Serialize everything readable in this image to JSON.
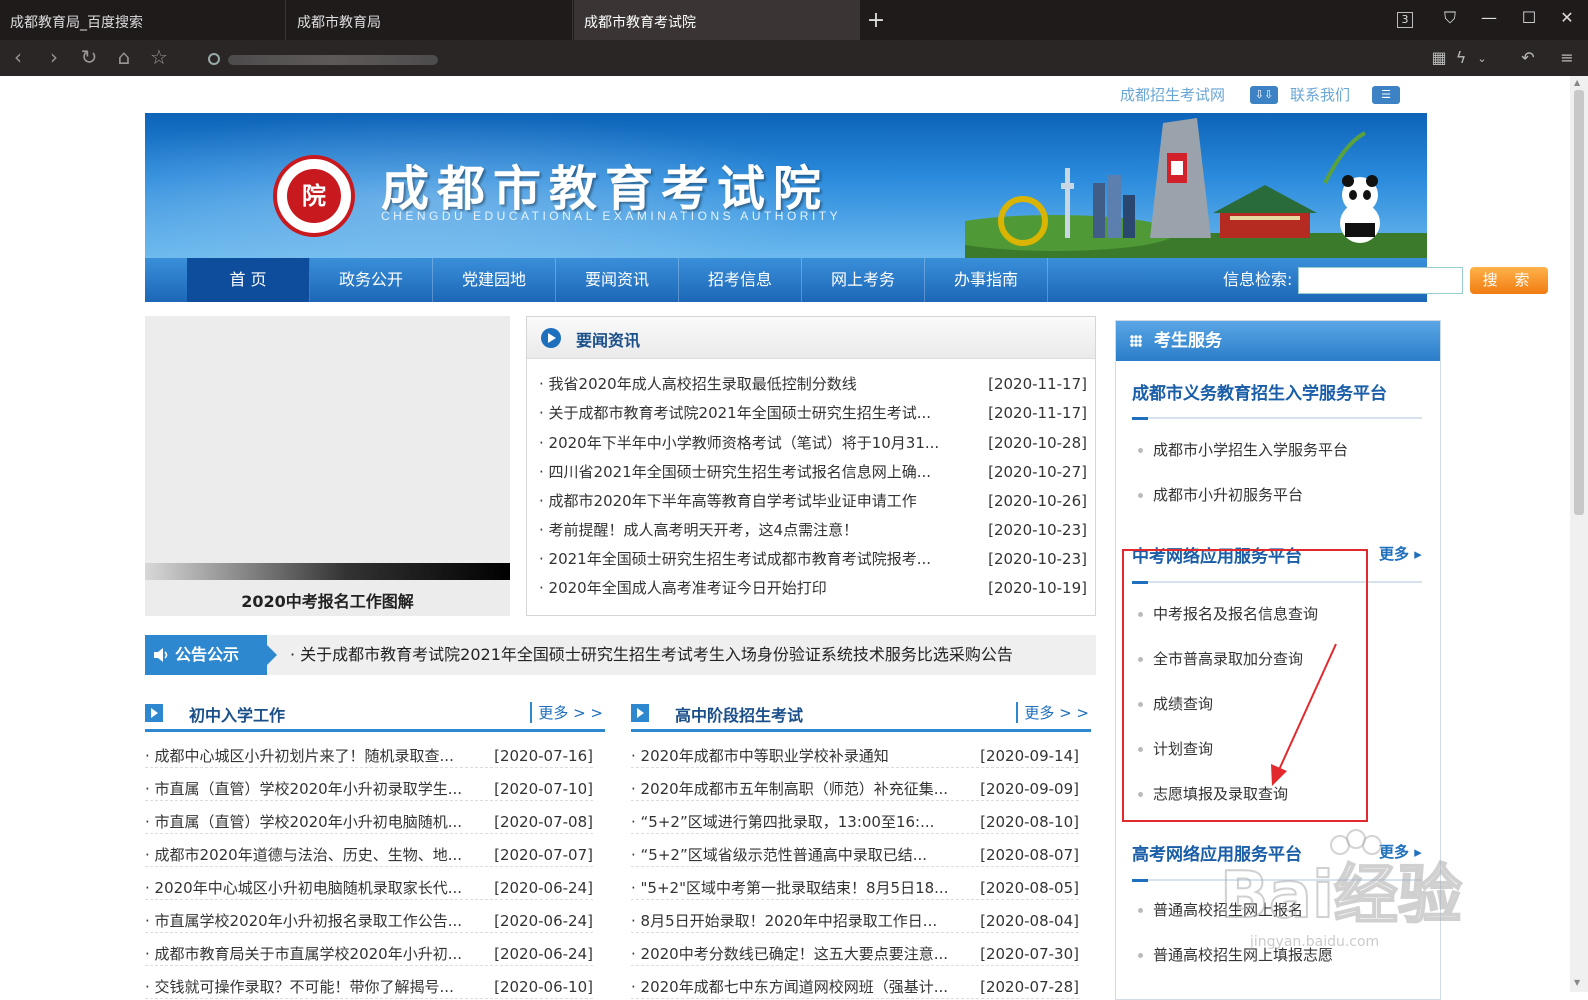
{
  "browser": {
    "tabs": [
      {
        "label": "成都教育局_百度搜索",
        "active": false
      },
      {
        "label": "成都市教育局",
        "active": false
      },
      {
        "label": "成都市教育考试院",
        "active": true
      }
    ],
    "new_tab": "+",
    "tab_count": "3",
    "icons": [
      "back-icon",
      "forward-icon",
      "reload-icon",
      "home-icon",
      "star-icon",
      "qr-icon",
      "lightning-icon",
      "undo-icon",
      "menu-icon"
    ]
  },
  "toplinks": {
    "link1": "成都招生考试网",
    "link2": "联系我们"
  },
  "banner": {
    "title": "成都市教育考试院",
    "subtitle": "CHENGDU EDUCATIONAL EXAMINATIONS AUTHORITY",
    "seal_char": "院"
  },
  "nav": {
    "items": [
      "首 页",
      "政务公开",
      "党建园地",
      "要闻资讯",
      "招考信息",
      "网上考务",
      "办事指南"
    ],
    "search_label": "信息检索:",
    "search_button": "搜 索"
  },
  "slide": {
    "caption": "2020中考报名工作图解"
  },
  "news": {
    "title": "要闻资讯",
    "items": [
      {
        "title": "· 我省2020年成人高校招生录取最低控制分数线",
        "date": "[2020-11-17]"
      },
      {
        "title": "· 关于成都市教育考试院2021年全国硕士研究生招生考试...",
        "date": "[2020-11-17]"
      },
      {
        "title": "· 2020年下半年中小学教师资格考试（笔试）将于10月31...",
        "date": "[2020-10-28]"
      },
      {
        "title": "· 四川省2021年全国硕士研究生招生考试报名信息网上确...",
        "date": "[2020-10-27]"
      },
      {
        "title": "· 成都市2020年下半年高等教育自学考试毕业证申请工作",
        "date": "[2020-10-26]"
      },
      {
        "title": "· 考前提醒！成人高考明天开考，这4点需注意！",
        "date": "[2020-10-23]"
      },
      {
        "title": "· 2021年全国硕士研究生招生考试成都市教育考试院报考...",
        "date": "[2020-10-23]"
      },
      {
        "title": "· 2020年全国成人高考准考证今日开始打印",
        "date": "[2020-10-19]"
      }
    ]
  },
  "notice": {
    "tag": "公告公示",
    "text": "· 关于成都市教育考试院2021年全国硕士研究生招生考试考生入场身份验证系统技术服务比选采购公告"
  },
  "col_left": {
    "title": "初中入学工作",
    "more": "更多 > >",
    "items": [
      {
        "title": "· 成都中心城区小升初划片来了！随机录取查...",
        "date": "[2020-07-16]"
      },
      {
        "title": "· 市直属（直管）学校2020年小升初录取学生...",
        "date": "[2020-07-10]"
      },
      {
        "title": "· 市直属（直管）学校2020年小升初电脑随机...",
        "date": "[2020-07-08]"
      },
      {
        "title": "· 成都市2020年道德与法治、历史、生物、地...",
        "date": "[2020-07-07]"
      },
      {
        "title": "· 2020年中心城区小升初电脑随机录取家长代...",
        "date": "[2020-06-24]"
      },
      {
        "title": "· 市直属学校2020年小升初报名录取工作公告...",
        "date": "[2020-06-24]"
      },
      {
        "title": "· 成都市教育局关于市直属学校2020年小升初...",
        "date": "[2020-06-24]"
      },
      {
        "title": "· 交钱就可操作录取？不可能！带你了解揭号...",
        "date": "[2020-06-10]"
      }
    ]
  },
  "col_right": {
    "title": "高中阶段招生考试",
    "more": "更多 > >",
    "items": [
      {
        "title": "· 2020年成都市中等职业学校补录通知",
        "date": "[2020-09-14]"
      },
      {
        "title": "· 2020年成都市五年制高职（师范）补充征集...",
        "date": "[2020-09-09]"
      },
      {
        "title": "· “5+2”区域进行第四批录取，13:00至16:...",
        "date": "[2020-08-10]"
      },
      {
        "title": "· “5+2”区域省级示范性普通高中录取已结...",
        "date": "[2020-08-07]"
      },
      {
        "title": "· \"5+2\"区域中考第一批录取结束！8月5日18...",
        "date": "[2020-08-05]"
      },
      {
        "title": "· 8月5日开始录取！2020年中招录取工作日...",
        "date": "[2020-08-04]"
      },
      {
        "title": "· 2020中考分数线已确定！这五大要点要注意...",
        "date": "[2020-07-30]"
      },
      {
        "title": "· 2020年成都七中东方闻道网校网班（强基计...",
        "date": "[2020-07-28]"
      }
    ]
  },
  "service": {
    "title": "考生服务",
    "sections": [
      {
        "title": "成都市义务教育招生入学服务平台",
        "more": "",
        "items": [
          "成都市小学招生入学服务平台",
          "成都市小升初服务平台"
        ]
      },
      {
        "title": "中考网络应用服务平台",
        "more": "更多",
        "items": [
          "中考报名及报名信息查询",
          "全市普高录取加分查询",
          "成绩查询",
          "计划查询",
          "志愿填报及录取查询"
        ]
      },
      {
        "title": "高考网络应用服务平台",
        "more": "更多",
        "items": [
          "普通高校招生网上报名",
          "普通高校招生网上填报志愿"
        ]
      }
    ]
  },
  "watermark": {
    "text": "jingyan.baidu.com"
  },
  "colors": {
    "primary": "#1e6fbd",
    "nav_active": "#0d4d9b",
    "highlight": "#e2292e"
  }
}
